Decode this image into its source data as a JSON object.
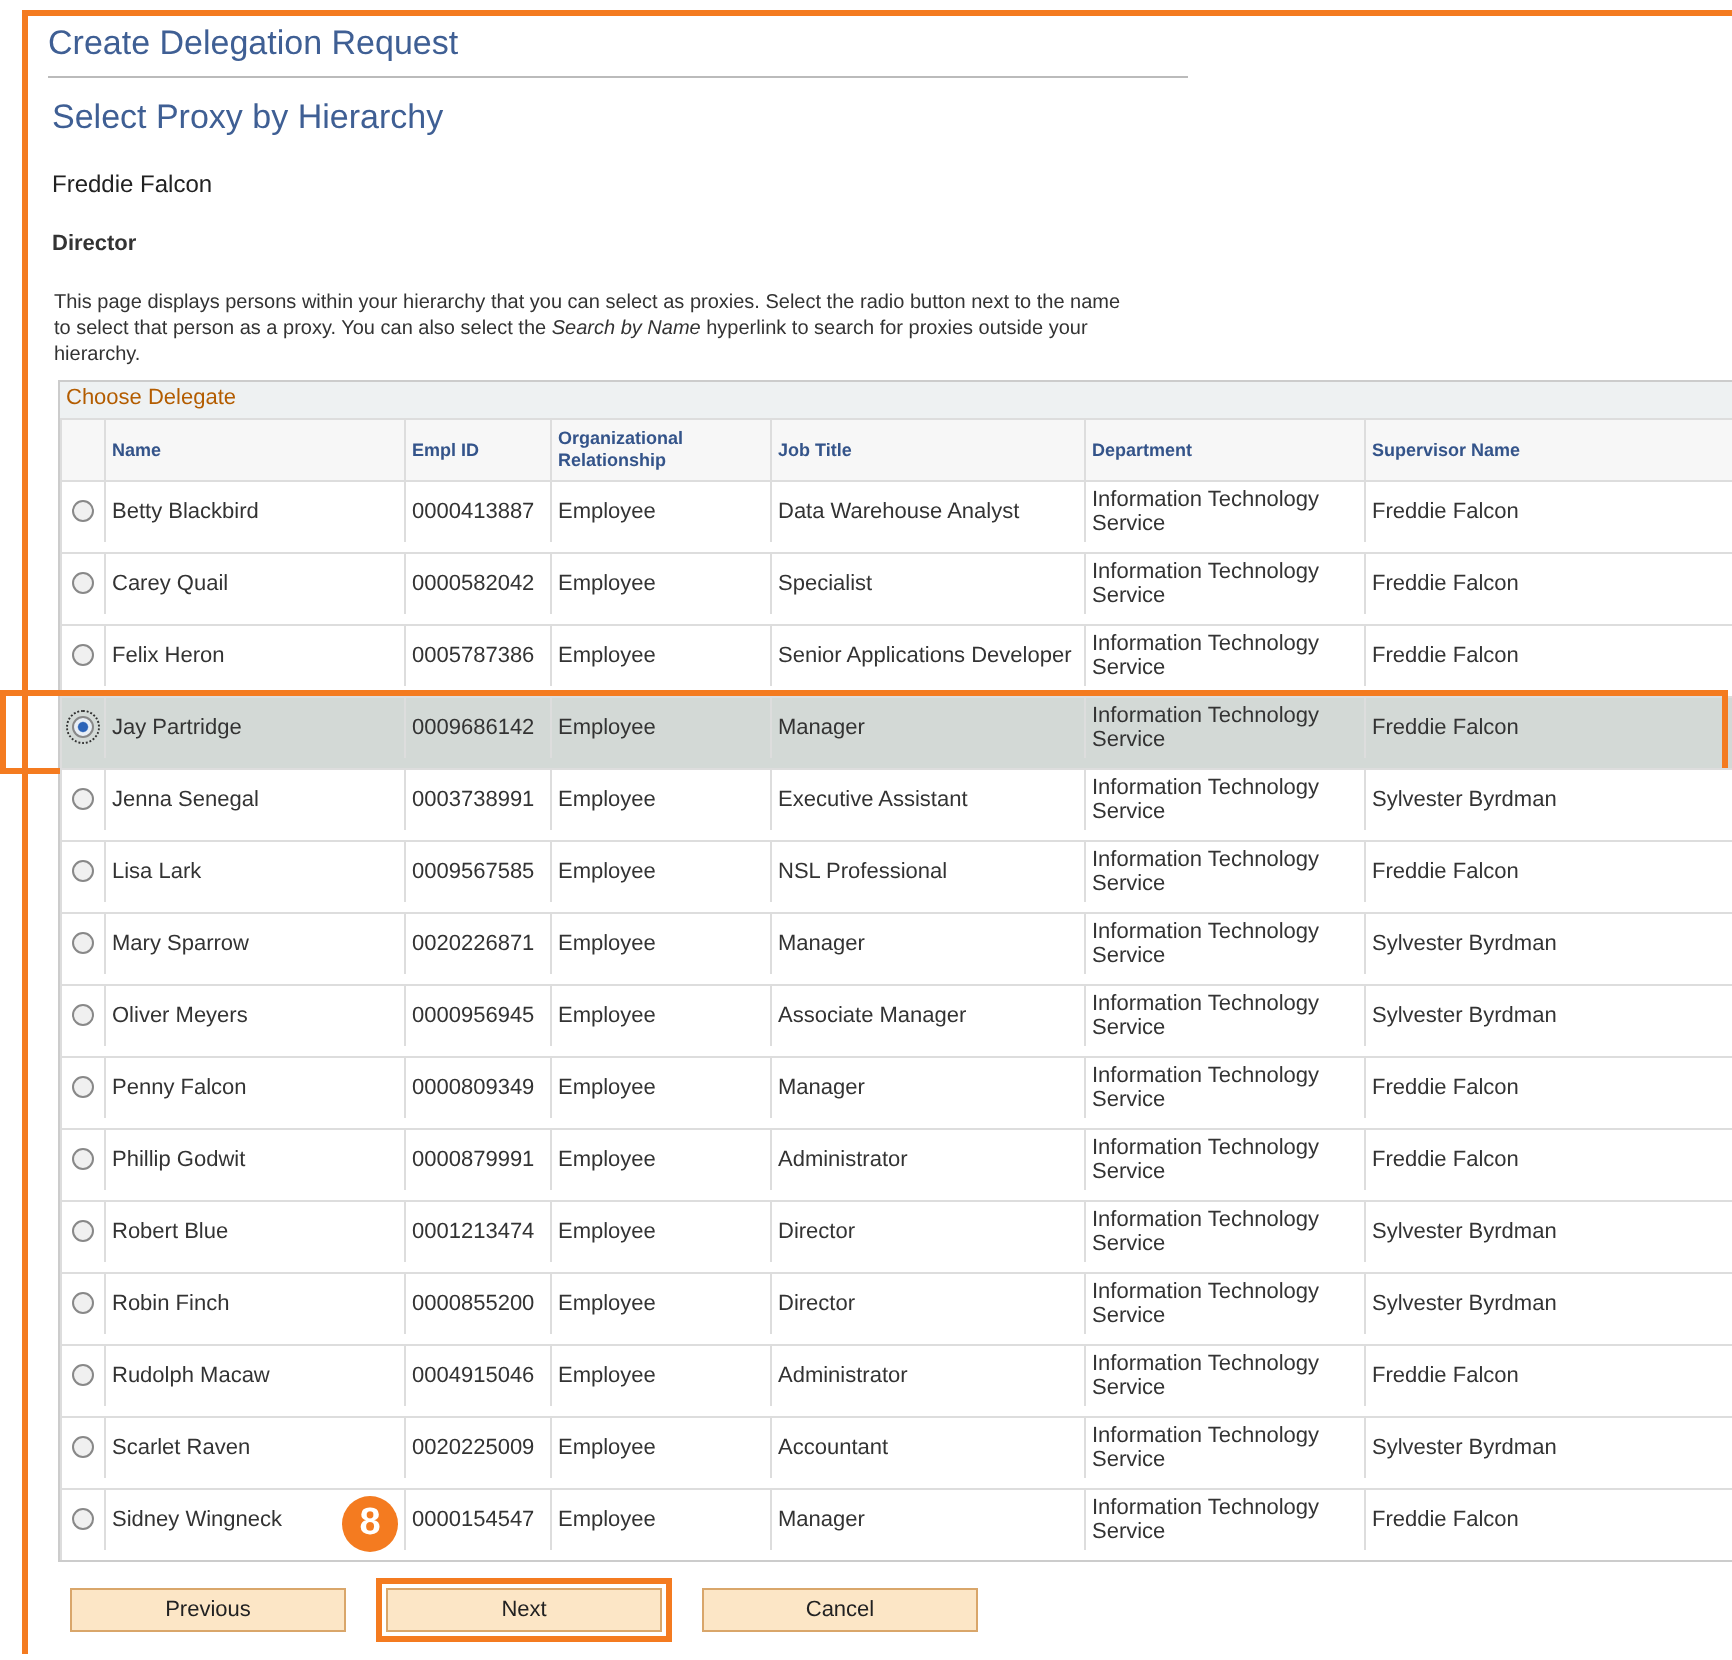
{
  "page_title": "Create Delegation Request",
  "subtitle": "Select Proxy by Hierarchy",
  "user_name": "Freddie Falcon",
  "user_title": "Director",
  "instructions": "This page displays persons within your hierarchy that you can select as proxies. Select the radio button next to the name to select that person as a proxy. You can also select the *Search by Name* hyperlink to search for proxies outside your hierarchy.",
  "table": {
    "caption": "Choose Delegate",
    "columns": [
      "Name",
      "Empl ID",
      "Organizational Relationship",
      "Job Title",
      "Department",
      "Supervisor Name"
    ],
    "rows": [
      {
        "cells": [
          "Betty Blackbird",
          "0000413887",
          "Employee",
          "Data Warehouse Analyst",
          "Information Technology Service",
          "Freddie Falcon"
        ],
        "selected": false
      },
      {
        "cells": [
          "Carey Quail",
          "0000582042",
          "Employee",
          "Specialist",
          "Information Technology Service",
          "Freddie Falcon"
        ],
        "selected": false
      },
      {
        "cells": [
          "Felix Heron",
          "0005787386",
          "Employee",
          "Senior Applications Developer",
          "Information Technology Service",
          "Freddie Falcon"
        ],
        "selected": false
      },
      {
        "cells": [
          "Jay Partridge",
          "0009686142",
          "Employee",
          "Manager",
          "Information Technology Service",
          "Freddie Falcon"
        ],
        "selected": true
      },
      {
        "cells": [
          "Jenna Senegal",
          "0003738991",
          "Employee",
          "Executive Assistant",
          "Information Technology Service",
          "Sylvester Byrdman"
        ],
        "selected": false
      },
      {
        "cells": [
          "Lisa Lark",
          "0009567585",
          "Employee",
          "NSL Professional",
          "Information Technology Service",
          "Freddie Falcon"
        ],
        "selected": false
      },
      {
        "cells": [
          "Mary Sparrow",
          "0020226871",
          "Employee",
          "Manager",
          "Information Technology Service",
          "Sylvester Byrdman"
        ],
        "selected": false
      },
      {
        "cells": [
          "Oliver Meyers",
          "0000956945",
          "Employee",
          "Associate Manager",
          "Information Technology Service",
          "Sylvester Byrdman"
        ],
        "selected": false
      },
      {
        "cells": [
          "Penny Falcon",
          "0000809349",
          "Employee",
          "Manager",
          "Information Technology Service",
          "Freddie Falcon"
        ],
        "selected": false
      },
      {
        "cells": [
          "Phillip Godwit",
          "0000879991",
          "Employee",
          "Administrator",
          "Information Technology Service",
          "Freddie Falcon"
        ],
        "selected": false
      },
      {
        "cells": [
          "Robert Blue",
          "0001213474",
          "Employee",
          "Director",
          "Information Technology Service",
          "Sylvester Byrdman"
        ],
        "selected": false
      },
      {
        "cells": [
          "Robin Finch",
          "0000855200",
          "Employee",
          "Director",
          "Information Technology Service",
          "Sylvester Byrdman"
        ],
        "selected": false
      },
      {
        "cells": [
          "Rudolph Macaw",
          "0004915046",
          "Employee",
          "Administrator",
          "Information Technology Service",
          "Freddie Falcon"
        ],
        "selected": false
      },
      {
        "cells": [
          "Scarlet Raven",
          "0020225009",
          "Employee",
          "Accountant",
          "Information Technology Service",
          "Sylvester Byrdman"
        ],
        "selected": false
      },
      {
        "cells": [
          "Sidney Wingneck",
          "0000154547",
          "Employee",
          "Manager",
          "Information Technology Service",
          "Freddie Falcon"
        ],
        "selected": false
      }
    ]
  },
  "buttons": [
    {
      "label": "Previous",
      "highlighted": false
    },
    {
      "label": "Next",
      "highlighted": true
    },
    {
      "label": "Cancel",
      "highlighted": false
    }
  ],
  "step_badge": "8"
}
